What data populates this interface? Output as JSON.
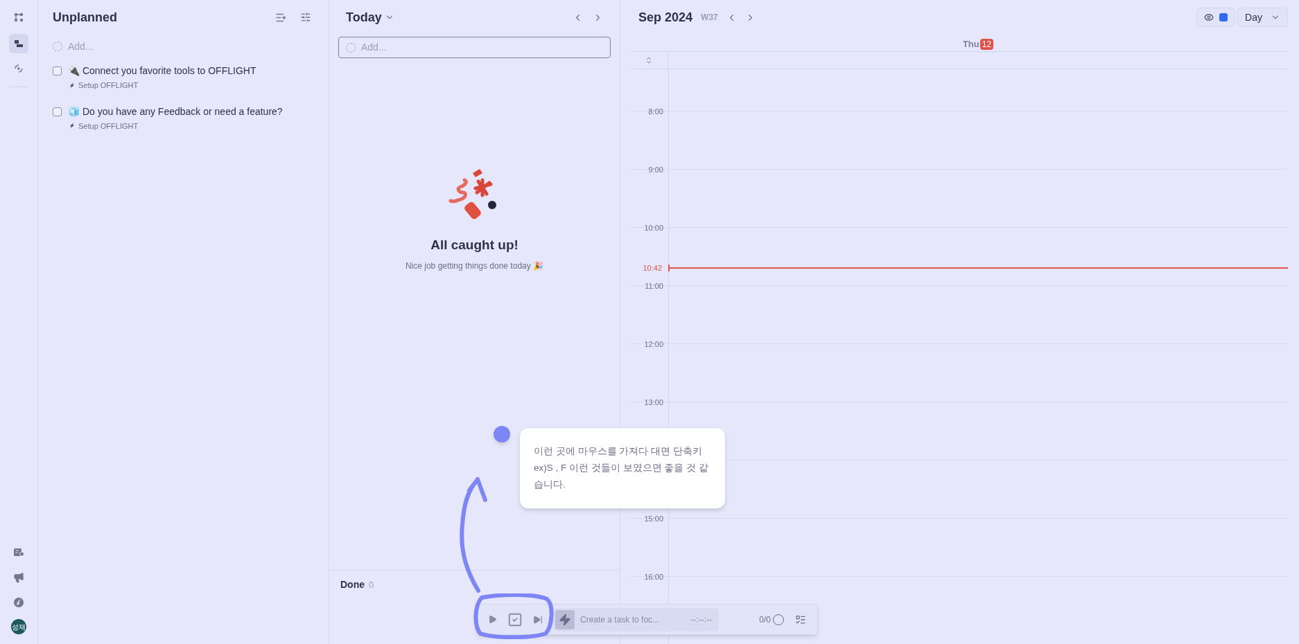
{
  "sidebar": {
    "avatar": "성재"
  },
  "unplanned": {
    "title": "Unplanned",
    "add_placeholder": "Add...",
    "tasks": [
      {
        "title": "🔌 Connect you favorite tools to OFFLIGHT",
        "project": "Setup OFFLIGHT",
        "checked": false
      },
      {
        "title": "🧊 Do you have any Feedback or need a feature?",
        "project": "Setup OFFLIGHT",
        "checked": false
      }
    ]
  },
  "today": {
    "title": "Today",
    "add_placeholder": "Add...",
    "empty_title": "All caught up!",
    "empty_subtitle": "Nice job getting things done today 🎉",
    "done_label": "Done",
    "done_count": "0"
  },
  "calendar": {
    "month": "Sep 2024",
    "week": "W37",
    "view": "Day",
    "day_name": "Thu",
    "day_number": "12",
    "now": "10:42",
    "hours": [
      {
        "label": "8:00"
      },
      {
        "label": "9:00"
      },
      {
        "label": "10:00"
      },
      {
        "label": "11:00"
      },
      {
        "label": "12:00"
      },
      {
        "label": "13:00"
      },
      {
        "covered": true
      },
      {
        "label": "15:00"
      },
      {
        "label": "16:00"
      }
    ]
  },
  "annotation": {
    "note": "이런 곳에 마우스를 가져다 대면 단축키 ex)S , F 이런 것들이 보였으면 좋을 것 같습니다."
  },
  "focus_bar": {
    "placeholder": "Create a task to foc...",
    "timer": "--:--:--",
    "progress": "0/0"
  }
}
